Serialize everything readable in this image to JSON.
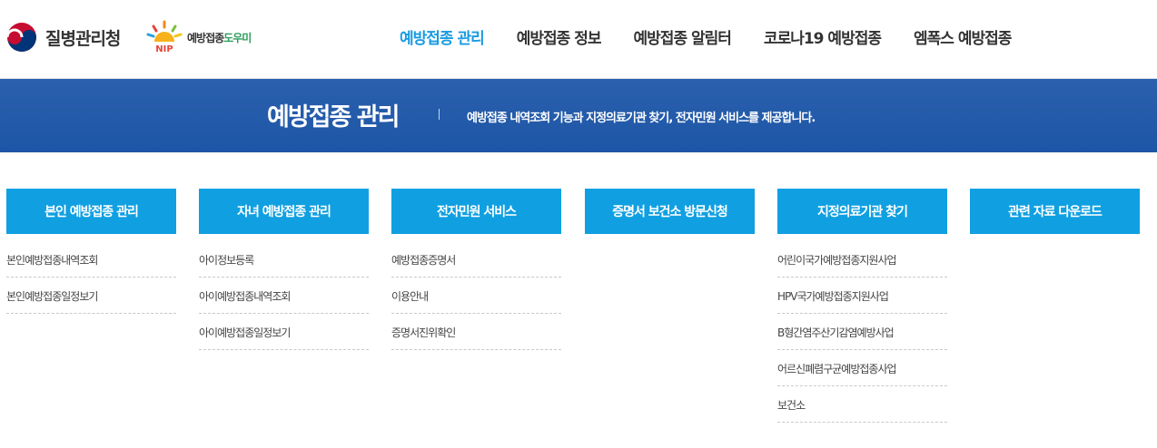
{
  "header": {
    "org_name": "질병관리청",
    "nip_logo_text": "NIP",
    "nip_title_a": "예방접종",
    "nip_title_b": "도우미",
    "nav": [
      {
        "label": "예방접종 관리",
        "active": true
      },
      {
        "label": "예방접종 정보",
        "active": false
      },
      {
        "label": "예방접종 알림터",
        "active": false
      },
      {
        "label": "코로나19 예방접종",
        "active": false
      },
      {
        "label": "엠폭스 예방접종",
        "active": false
      }
    ]
  },
  "banner": {
    "title": "예방접종 관리",
    "description": "예방접종 내역조회 기능과 지정의료기관 찾기, 전자민원 서비스를 제공합니다."
  },
  "colors": {
    "accent": "#1a9be0",
    "banner": "#2a60ad",
    "button": "#10a0e2"
  },
  "columns": [
    {
      "title": "본인 예방접종 관리",
      "links": [
        "본인예방접종내역조회",
        "본인예방접종일정보기"
      ]
    },
    {
      "title": "자녀 예방접종 관리",
      "links": [
        "아이정보등록",
        "아이예방접종내역조회",
        "아이예방접종일정보기"
      ]
    },
    {
      "title": "전자민원 서비스",
      "links": [
        "예방접종증명서",
        "이용안내",
        "증명서진위확인"
      ]
    },
    {
      "title": "증명서 보건소 방문신청",
      "links": []
    },
    {
      "title": "지정의료기관 찾기",
      "links": [
        "어린이국가예방접종지원사업",
        "HPV국가예방접종지원사업",
        "B형간염주산기감염예방사업",
        "어르신폐렴구균예방접종사업",
        "보건소"
      ]
    },
    {
      "title": "관련 자료 다운로드",
      "links": []
    }
  ]
}
